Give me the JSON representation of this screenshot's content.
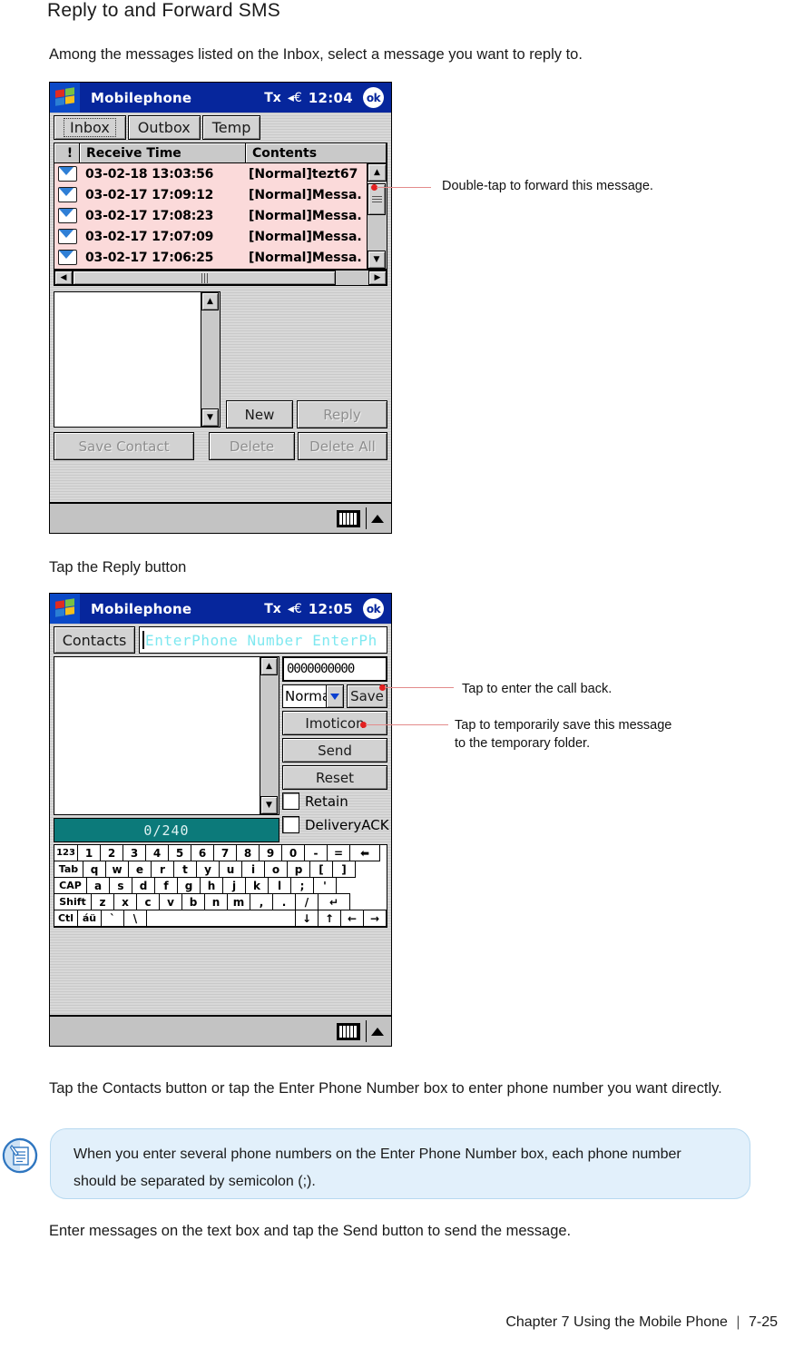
{
  "document": {
    "heading": "Reply to and Forward SMS",
    "intro": "Among the messages listed on the Inbox, select a message you want to reply to.",
    "reply_caption": "Tap the Reply button",
    "contacts_para": "Tap the Contacts button or tap the Enter Phone Number box to enter phone number you want directly.",
    "enter_para": "Enter messages on the text box and tap the Send button to send the message.",
    "note_text": "When you enter several phone numbers on the Enter Phone Number box, each phone number should be separated by semicolon (;).",
    "footer_chapter": "Chapter 7 Using the Mobile Phone",
    "footer_sep": "|",
    "footer_page": "7-25",
    "note_icon": "note-document-icon",
    "accent_note_bg": "#e2f0fb",
    "accent_leader": "#e38b8b",
    "accent_dot": "#e32020"
  },
  "callouts": [
    {
      "id": "forward",
      "text": "Double-tap to forward this message."
    },
    {
      "id": "callback",
      "text": "Tap to enter the call back."
    },
    {
      "id": "tempsave",
      "text": "Tap to temporarily save this message\nto the temporary folder."
    }
  ],
  "screenshot1": {
    "titlebar": {
      "logo_icon": "windows-logo-icon",
      "title": "Mobilephone",
      "signal_icon": "signal-off-icon",
      "signal_glyph": "Τx",
      "volume_icon": "volume-icon",
      "volume_glyph": "◂€",
      "clock": "12:04",
      "ok_label": "ok"
    },
    "tabs": [
      {
        "label": "Inbox",
        "selected": true
      },
      {
        "label": "Outbox",
        "selected": false
      },
      {
        "label": "Temp",
        "selected": false
      }
    ],
    "list": {
      "columns": [
        "!",
        "Receive Time",
        "Contents"
      ],
      "rows": [
        {
          "icon": "envelope-icon",
          "time": "03-02-18 13:03:56",
          "contents": "[Normal]tezt67"
        },
        {
          "icon": "envelope-icon",
          "time": "03-02-17 17:09:12",
          "contents": "[Normal]Messa."
        },
        {
          "icon": "envelope-icon",
          "time": "03-02-17 17:08:23",
          "contents": "[Normal]Messa."
        },
        {
          "icon": "envelope-icon",
          "time": "03-02-17 17:07:09",
          "contents": "[Normal]Messa."
        },
        {
          "icon": "envelope-icon",
          "time": "03-02-17 17:06:25",
          "contents": "[Normal]Messa."
        }
      ],
      "row_bg": "#fbdada"
    },
    "buttons": {
      "new": "New",
      "reply": "Reply",
      "save_contact": "Save Contact",
      "delete": "Delete",
      "delete_all": "Delete All"
    },
    "taskbar": {
      "keyboard_icon": "keyboard-icon",
      "expand_icon": "triangle-up-icon"
    }
  },
  "screenshot2": {
    "titlebar": {
      "logo_icon": "windows-logo-icon",
      "title": "Mobilephone",
      "signal_glyph": "Τx",
      "volume_glyph": "◂€",
      "clock": "12:05",
      "ok_label": "ok"
    },
    "contacts_button": "Contacts",
    "phone_field_placeholder": "EnterPhone Number  EnterPh",
    "callback_value": "0000000000",
    "priority_value": "Norma",
    "buttons": {
      "save": "Save",
      "imoticon": "Imoticon",
      "send": "Send",
      "reset": "Reset"
    },
    "checkboxes": [
      {
        "label": "Retain",
        "checked": false
      },
      {
        "label": "DeliveryACK",
        "checked": false
      }
    ],
    "counter": "0/240",
    "keyboard": {
      "row1": [
        "123",
        "1",
        "2",
        "3",
        "4",
        "5",
        "6",
        "7",
        "8",
        "9",
        "0",
        "-",
        "=",
        "⬅"
      ],
      "row2": [
        "Tab",
        "q",
        "w",
        "e",
        "r",
        "t",
        "y",
        "u",
        "i",
        "o",
        "p",
        "[",
        "]"
      ],
      "row3": [
        "CAP",
        "a",
        "s",
        "d",
        "f",
        "g",
        "h",
        "j",
        "k",
        "l",
        ";",
        "'"
      ],
      "row4": [
        "Shift",
        "z",
        "x",
        "c",
        "v",
        "b",
        "n",
        "m",
        ",",
        ".",
        "/",
        "↵"
      ],
      "row5": [
        "Ctl",
        "áü",
        "`",
        "\\",
        " ",
        "↓",
        "↑",
        "←",
        "→"
      ]
    },
    "taskbar": {
      "keyboard_icon": "keyboard-icon",
      "expand_icon": "triangle-up-icon"
    }
  }
}
